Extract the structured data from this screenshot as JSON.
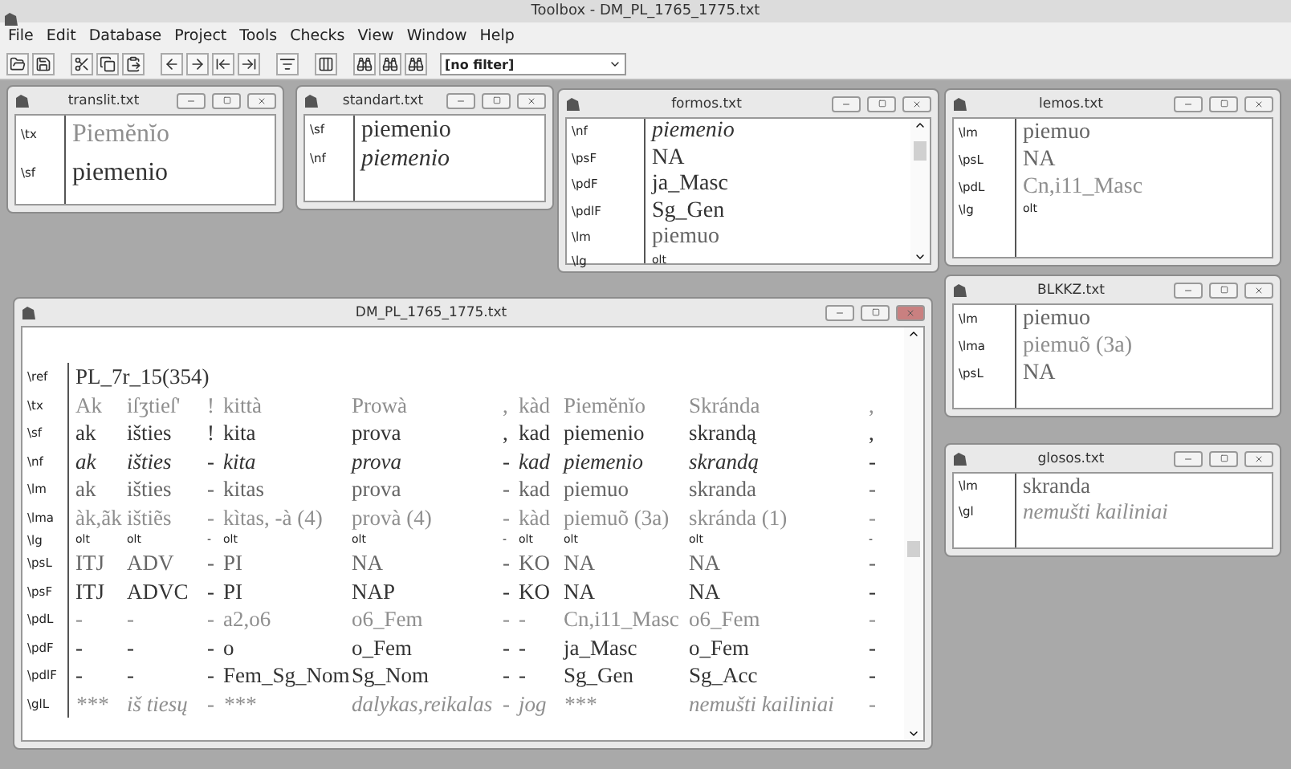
{
  "window": {
    "title": "Toolbox - DM_PL_1765_1775.txt"
  },
  "menu": [
    "File",
    "Edit",
    "Database",
    "Project",
    "Tools",
    "Checks",
    "View",
    "Window",
    "Help"
  ],
  "toolbar": {
    "filter": "[no filter]"
  },
  "windows": [
    {
      "title": "translit.txt",
      "active": false,
      "lines": [
        {
          "marker": "\\tx",
          "text": "Piemĕnĭo",
          "kind": "gray"
        },
        {
          "marker": "\\sf",
          "text": "piemenio",
          "kind": "text"
        }
      ]
    },
    {
      "title": "standart.txt",
      "active": false,
      "lines": [
        {
          "marker": "\\sf",
          "text": "piemenio",
          "kind": "text"
        },
        {
          "marker": "\\nf",
          "text": "piemenio",
          "kind": "italic"
        }
      ]
    },
    {
      "title": "formos.txt",
      "active": false,
      "lines": [
        {
          "marker": "\\nf",
          "text": "piemenio",
          "kind": "italic"
        },
        {
          "marker": "\\psF",
          "text": "NA",
          "kind": "text"
        },
        {
          "marker": "\\pdF",
          "text": "ja_Masc",
          "kind": "text"
        },
        {
          "marker": "\\pdlF",
          "text": "Sg_Gen",
          "kind": "text"
        },
        {
          "marker": "\\lm",
          "text": "piemuo",
          "kind": "soft"
        },
        {
          "marker": "\\lg",
          "text": "olt",
          "kind": "small"
        }
      ]
    },
    {
      "title": "lemos.txt",
      "active": false,
      "lines": [
        {
          "marker": "\\lm",
          "text": "piemuo",
          "kind": "soft"
        },
        {
          "marker": "\\psL",
          "text": "NA",
          "kind": "soft"
        },
        {
          "marker": "\\pdL",
          "text": "Cn,i11_Masc",
          "kind": "gray"
        },
        {
          "marker": "\\lg",
          "text": "olt",
          "kind": "small"
        }
      ]
    },
    {
      "title": "DM_PL_1765_1775.txt",
      "active": true,
      "rows": [
        {
          "marker": "\\ref",
          "kind": "text",
          "cells": [
            "PL_7r_15(354)"
          ]
        },
        {
          "marker": "\\tx",
          "kind": "gray",
          "cells": [
            "Ak",
            "iſʒtieſ'",
            "!",
            "kittà",
            "Prowà",
            ",",
            "kàd",
            "Piemĕnĭo",
            "Skránda",
            ","
          ]
        },
        {
          "marker": "\\sf",
          "kind": "text",
          "cells": [
            "ak",
            "išties",
            "!",
            "kita",
            "prova",
            ",",
            "kad",
            "piemenio",
            "skrandą",
            ","
          ]
        },
        {
          "marker": "\\nf",
          "kind": "italic",
          "cells": [
            "ak",
            "išties",
            "-",
            "kita",
            "prova",
            "-",
            "kad",
            "piemenio",
            "skrandą",
            "-"
          ]
        },
        {
          "marker": "\\lm",
          "kind": "soft",
          "cells": [
            "ak",
            "išties",
            "-",
            "kitas",
            "prova",
            "-",
            "kad",
            "piemuo",
            "skranda",
            "-"
          ]
        },
        {
          "marker": "\\lma",
          "kind": "gray",
          "cells": [
            "àk,ãk",
            "ištiẽs",
            "-",
            "kìtas, -à (4)",
            "provà (4)",
            "-",
            "kàd",
            "piemuõ (3a)",
            "skránda (1)",
            "-"
          ]
        },
        {
          "marker": "\\lg",
          "kind": "small",
          "cells": [
            "olt",
            "olt",
            "-",
            "olt",
            "olt",
            "-",
            "olt",
            "olt",
            "olt",
            "-"
          ]
        },
        {
          "marker": "\\psL",
          "kind": "soft",
          "cells": [
            "ITJ",
            "ADV",
            "-",
            "PI",
            "NA",
            "-",
            "KO",
            "NA",
            "NA",
            "-"
          ]
        },
        {
          "marker": "\\psF",
          "kind": "text",
          "cells": [
            "ITJ",
            "ADVC",
            "-",
            "PI",
            "NAP",
            "-",
            "KO",
            "NA",
            "NA",
            "-"
          ]
        },
        {
          "marker": "\\pdL",
          "kind": "gray",
          "cells": [
            "-",
            "-",
            "-",
            "a2,o6",
            "o6_Fem",
            "-",
            "-",
            "Cn,i11_Masc",
            "o6_Fem",
            "-"
          ]
        },
        {
          "marker": "\\pdF",
          "kind": "text",
          "cells": [
            "-",
            "-",
            "-",
            "o",
            "o_Fem",
            "-",
            "-",
            "ja_Masc",
            "o_Fem",
            "-"
          ]
        },
        {
          "marker": "\\pdlF",
          "kind": "text",
          "cells": [
            "-",
            "-",
            "-",
            "Fem_Sg_Nom",
            "Sg_Nom",
            "-",
            "-",
            "Sg_Gen",
            "Sg_Acc",
            "-"
          ]
        },
        {
          "marker": "\\glL",
          "kind": "gray-italic",
          "cells": [
            "***",
            "iš tiesų",
            "-",
            "***",
            "dalykas,reikalas",
            "-",
            "jog",
            "***",
            "nemušti kailiniai",
            "-"
          ]
        }
      ]
    },
    {
      "title": "BLKKZ.txt",
      "active": false,
      "lines": [
        {
          "marker": "\\lm",
          "text": "piemuo",
          "kind": "soft"
        },
        {
          "marker": "\\lma",
          "text": "piemuõ (3a)",
          "kind": "gray"
        },
        {
          "marker": "\\psL",
          "text": "NA",
          "kind": "soft"
        }
      ]
    },
    {
      "title": "glosos.txt",
      "active": false,
      "lines": [
        {
          "marker": "\\lm",
          "text": "skranda",
          "kind": "soft"
        },
        {
          "marker": "\\gl",
          "text": "nemušti  kailiniai",
          "kind": "gray-italic"
        }
      ]
    }
  ]
}
